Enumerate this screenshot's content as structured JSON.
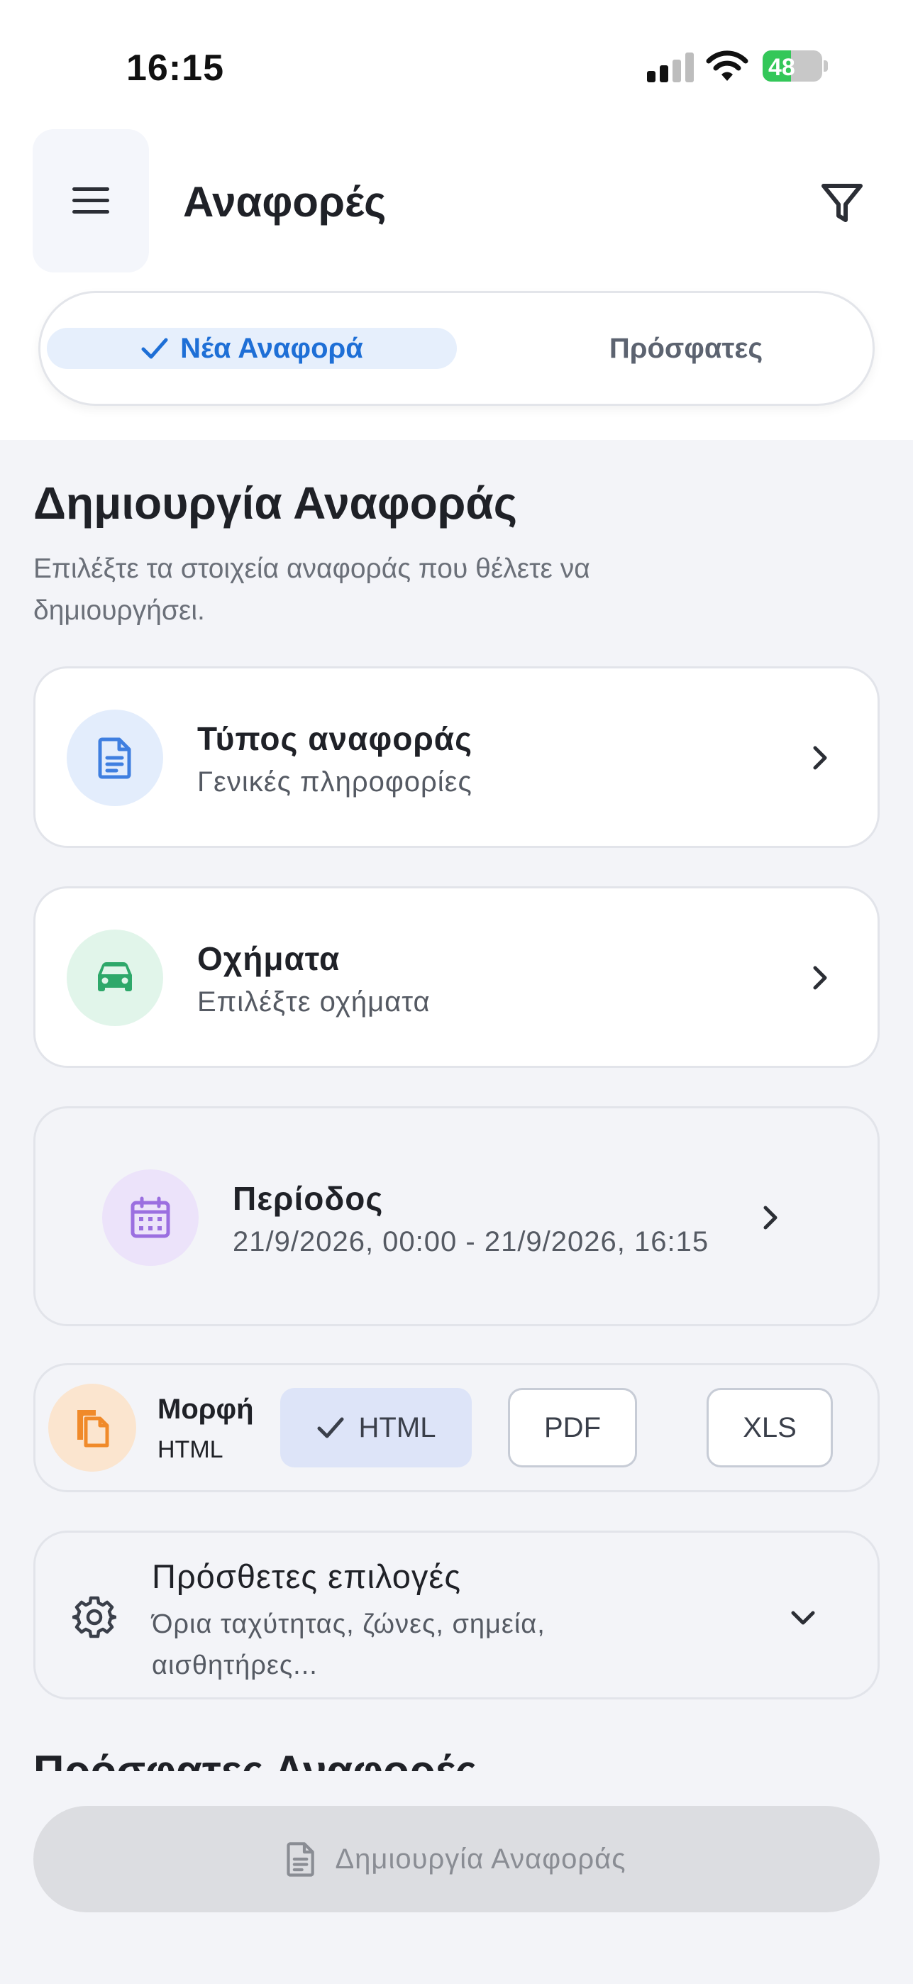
{
  "status_bar": {
    "time": "16:15",
    "battery": "48",
    "battery_level": 0.48
  },
  "header": {
    "title": "Αναφορές",
    "menu_icon": "hamburger-icon",
    "filter_icon": "filter-icon"
  },
  "tabs": {
    "active": "Νέα Αναφορά",
    "inactive": "Πρόσφατες"
  },
  "section": {
    "title": "Δημιουργία Αναφοράς",
    "subtitle": "Επιλέξτε τα στοιχεία αναφοράς που θέλετε να δημιουργήσει."
  },
  "cards": {
    "report_type": {
      "title": "Τύπος αναφοράς",
      "subtitle": "Γενικές πληροφορίες",
      "icon": "document-icon",
      "color": "#3f7fe0"
    },
    "vehicles": {
      "title": "Οχήματα",
      "subtitle": "Επιλέξτε οχήματα",
      "icon": "car-icon",
      "color": "#2ea86a"
    },
    "period": {
      "title": "Περίοδος",
      "subtitle": "21/9/2026, 00:00 - 21/9/2026, 16:15",
      "icon": "calendar-icon",
      "color": "#9b6fe0"
    }
  },
  "format": {
    "label": "Μορφή",
    "value": "HTML",
    "icon": "copy-icon",
    "color": "#f08a2a",
    "options": [
      "HTML",
      "PDF",
      "XLS"
    ],
    "selected": "HTML"
  },
  "extra_options": {
    "title": "Πρόσθετες επιλογές",
    "subtitle": "Όρια ταχύτητας, ζώνες, σημεία, αισθητήρες...",
    "icon": "gear-icon"
  },
  "recent_section_title": "Πρόσφατες Αναφορές",
  "cta": {
    "label": "Δημιουργία Αναφοράς",
    "icon": "document-icon"
  }
}
